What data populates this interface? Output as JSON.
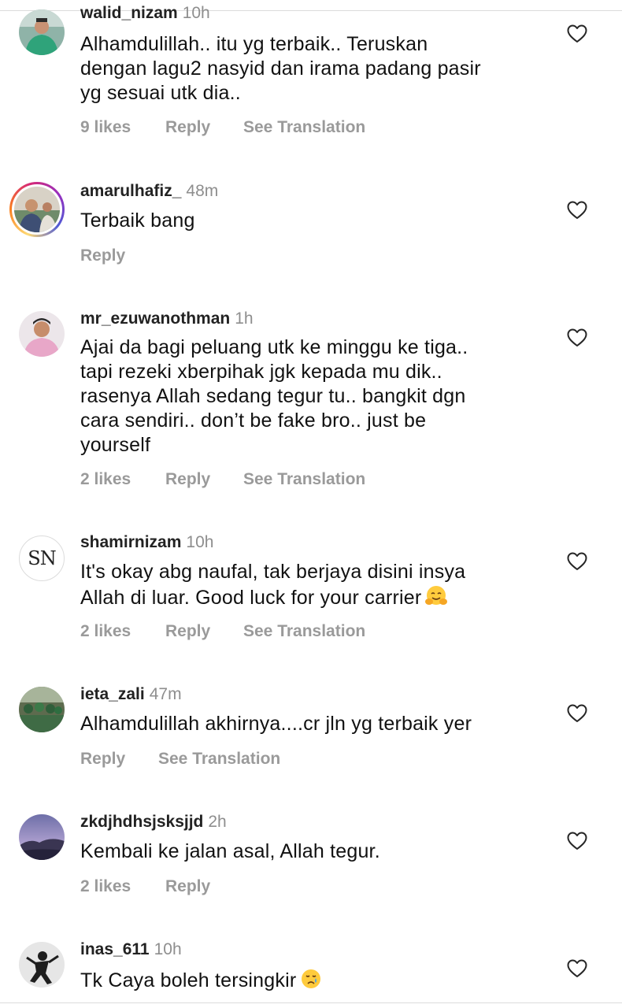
{
  "comments": [
    {
      "username": "walid_nizam",
      "time": "10h",
      "text": "Alhamdulillah.. itu yg terbaik.. Teruskan\ndengan lagu2 nasyid dan irama padang pasir\nyg sesuai utk dia..",
      "likes": "9 likes",
      "reply": "Reply",
      "translate": "See Translation",
      "avatar": "person-in-green-shirt"
    },
    {
      "username": "amarulhafiz_",
      "time": "48m",
      "text": "Terbaik bang",
      "likes": "",
      "reply": "Reply",
      "translate": "",
      "avatar": "person-with-story-ring"
    },
    {
      "username": "mr_ezuwanothman",
      "time": "1h",
      "text": "Ajai da bagi peluang utk ke minggu ke tiga..\ntapi rezeki xberpihak jgk kepada mu dik..\nrasenya Allah sedang tegur tu.. bangkit dgn\ncara sendiri.. don’t be fake bro.. just be\nyourself",
      "likes": "2 likes",
      "reply": "Reply",
      "translate": "See Translation",
      "avatar": "person-in-pink-shirt"
    },
    {
      "username": "shamirnizam",
      "time": "10h",
      "text": "It's okay abg naufal, tak berjaya disini insya\nAllah di luar. Good luck for your carrier",
      "emoji": "hugging-face-emoji",
      "likes": "2 likes",
      "reply": "Reply",
      "translate": "See Translation",
      "avatar_text": "SN"
    },
    {
      "username": "ieta_zali",
      "time": "47m",
      "text": "Alhamdulillah akhirnya....cr jln yg terbaik yer",
      "likes": "",
      "reply": "Reply",
      "translate": "See Translation",
      "avatar": "group-photo-green"
    },
    {
      "username": "zkdjhdhsjsksjjd",
      "time": "2h",
      "text": "Kembali ke jalan asal, Allah tegur.",
      "likes": "2 likes",
      "reply": "Reply",
      "translate": "",
      "avatar": "mountain-landscape"
    },
    {
      "username": "inas_611",
      "time": "10h",
      "text": "Tk Caya boleh tersingkir",
      "emoji": "crying-face-emoji",
      "likes": "",
      "reply": "",
      "translate": "",
      "avatar": "black-white-figure"
    }
  ],
  "colors": {
    "text": "#111111",
    "meta": "#8e8e8e",
    "action": "#9a9a9a",
    "divider": "#dbdbdb"
  }
}
